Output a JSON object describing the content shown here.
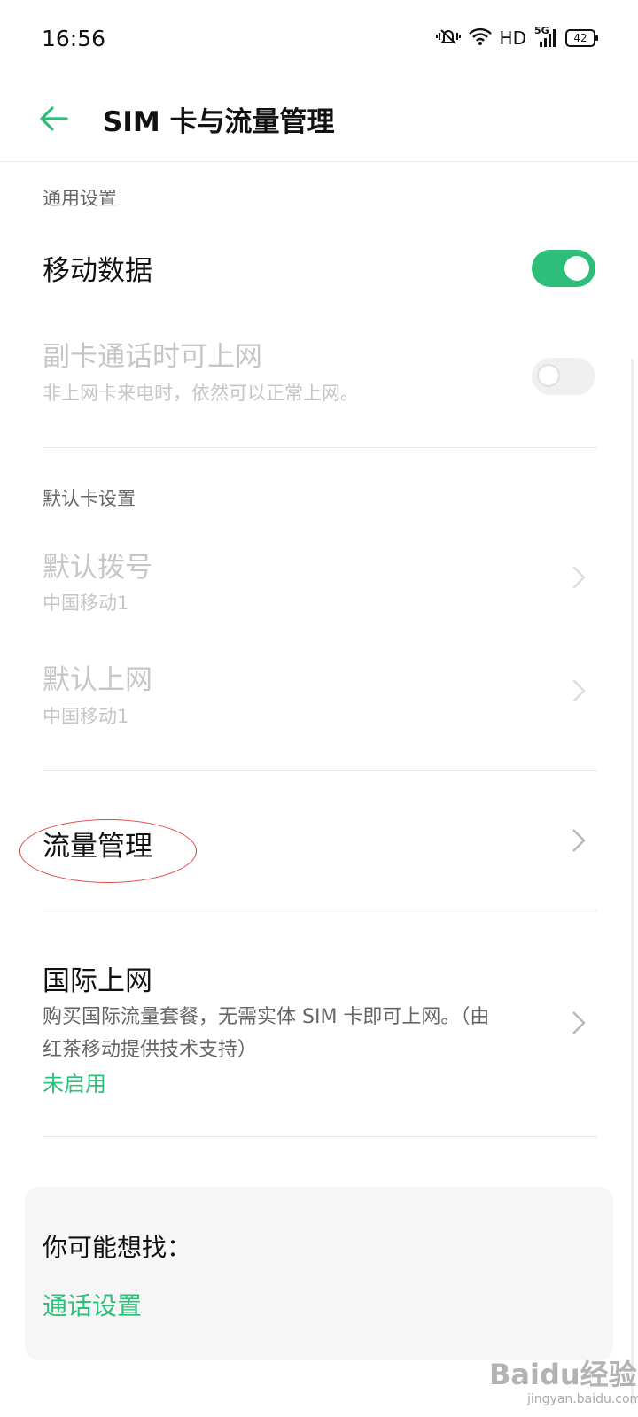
{
  "status_bar": {
    "time": "16:56",
    "hd": "HD",
    "net": "5G",
    "battery": "42"
  },
  "header": {
    "title": "SIM 卡与流量管理"
  },
  "general": {
    "label": "通用设置",
    "mobile_data": {
      "title": "移动数据",
      "enabled": true
    },
    "secondary_card": {
      "title": "副卡通话时可上网",
      "subtitle": "非上网卡来电时，依然可以正常上网。",
      "enabled": false
    }
  },
  "default_card": {
    "label": "默认卡设置",
    "dial": {
      "title": "默认拨号",
      "value": "中国移动1"
    },
    "internet": {
      "title": "默认上网",
      "value": "中国移动1"
    }
  },
  "traffic_management": {
    "title": "流量管理"
  },
  "international": {
    "title": "国际上网",
    "desc_line1": "购买国际流量套餐，无需实体 SIM 卡即可上网。（由",
    "desc_line2": "红茶移动提供技术支持）",
    "status": "未启用"
  },
  "suggest": {
    "title": "你可能想找：",
    "link": "通话设置"
  },
  "watermark": {
    "brand": "Baidu经验",
    "url": "jingyan.baidu.com"
  },
  "colors": {
    "accent": "#2dbe79",
    "annotation": "#dd4444"
  }
}
